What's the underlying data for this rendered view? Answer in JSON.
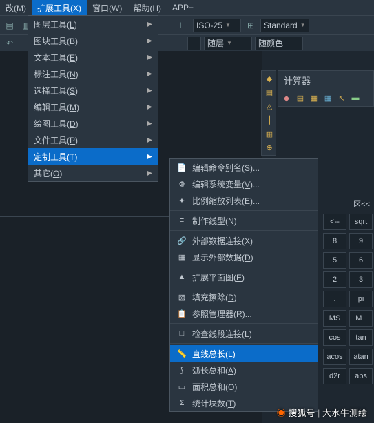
{
  "menubar": [
    {
      "label": "改",
      "hot": "M",
      "active": false
    },
    {
      "label": "扩展工具",
      "hot": "X",
      "active": true
    },
    {
      "label": "窗口",
      "hot": "W",
      "active": false
    },
    {
      "label": "帮助",
      "hot": "H",
      "active": false
    },
    {
      "label": "APP+",
      "hot": "",
      "active": false
    }
  ],
  "combos": {
    "iso": "ISO-25",
    "std": "Standard",
    "layer": "随层",
    "color": "随颜色"
  },
  "menu1": [
    {
      "label": "图层工具",
      "hot": "L",
      "sub": true
    },
    {
      "label": "图块工具",
      "hot": "B",
      "sub": true
    },
    {
      "label": "文本工具",
      "hot": "E",
      "sub": true
    },
    {
      "label": "标注工具",
      "hot": "N",
      "sub": true
    },
    {
      "label": "选择工具",
      "hot": "S",
      "sub": true
    },
    {
      "label": "编辑工具",
      "hot": "M",
      "sub": true
    },
    {
      "label": "绘图工具",
      "hot": "D",
      "sub": true
    },
    {
      "label": "文件工具",
      "hot": "P",
      "sub": true
    },
    {
      "label": "定制工具",
      "hot": "T",
      "sub": true,
      "selected": true
    },
    {
      "label": "其它",
      "hot": "O",
      "sub": true
    }
  ],
  "menu2": [
    {
      "ico": "📄",
      "label": "编辑命令别名",
      "hot": "S",
      "more": "..."
    },
    {
      "ico": "⚙",
      "label": "编辑系统变量",
      "hot": "V",
      "more": "..."
    },
    {
      "ico": "✦",
      "label": "比例缩放列表",
      "hot": "E",
      "more": "...",
      "sep_after": true
    },
    {
      "ico": "≡",
      "label": "制作线型",
      "hot": "N",
      "sep_after": true
    },
    {
      "ico": "🔗",
      "label": "外部数据连接",
      "hot": "X"
    },
    {
      "ico": "▦",
      "label": "显示外部数据",
      "hot": "D",
      "sep_after": true
    },
    {
      "ico": "▲",
      "label": "扩展平面图",
      "hot": "E",
      "sep_after": true
    },
    {
      "ico": "▨",
      "label": "填充擦除",
      "hot": "D"
    },
    {
      "ico": "📋",
      "label": "参照管理器",
      "hot": "R",
      "more": "...",
      "sep_after": true
    },
    {
      "ico": "□",
      "label": "检查线段连接",
      "hot": "L",
      "sep_after": true
    },
    {
      "ico": "📏",
      "label": "直线总长",
      "hot": "L",
      "selected": true
    },
    {
      "ico": "⟆",
      "label": "弧长总和",
      "hot": "A"
    },
    {
      "ico": "▭",
      "label": "面积总和",
      "hot": "O"
    },
    {
      "ico": "Σ",
      "label": "统计块数",
      "hot": "T"
    }
  ],
  "vtool": [
    "◆",
    "▤",
    "◬",
    "┃",
    "▦",
    "⊕"
  ],
  "panel": {
    "title": "计算器",
    "icons": [
      "◆",
      "▤",
      "▦",
      "▦",
      "↖",
      "▬"
    ]
  },
  "calc_hdr": {
    "back": "区<<",
    "sqrt": "sqrt",
    "arrow": "<--"
  },
  "calc": [
    "8",
    "9",
    "5",
    "6",
    "2",
    "3",
    ".",
    "pi",
    "MS",
    "M+",
    "cos",
    "tan",
    "acos",
    "atan",
    "d2r",
    "abs"
  ],
  "watermark": {
    "brand": "搜狐号",
    "author": "大水牛测绘"
  }
}
